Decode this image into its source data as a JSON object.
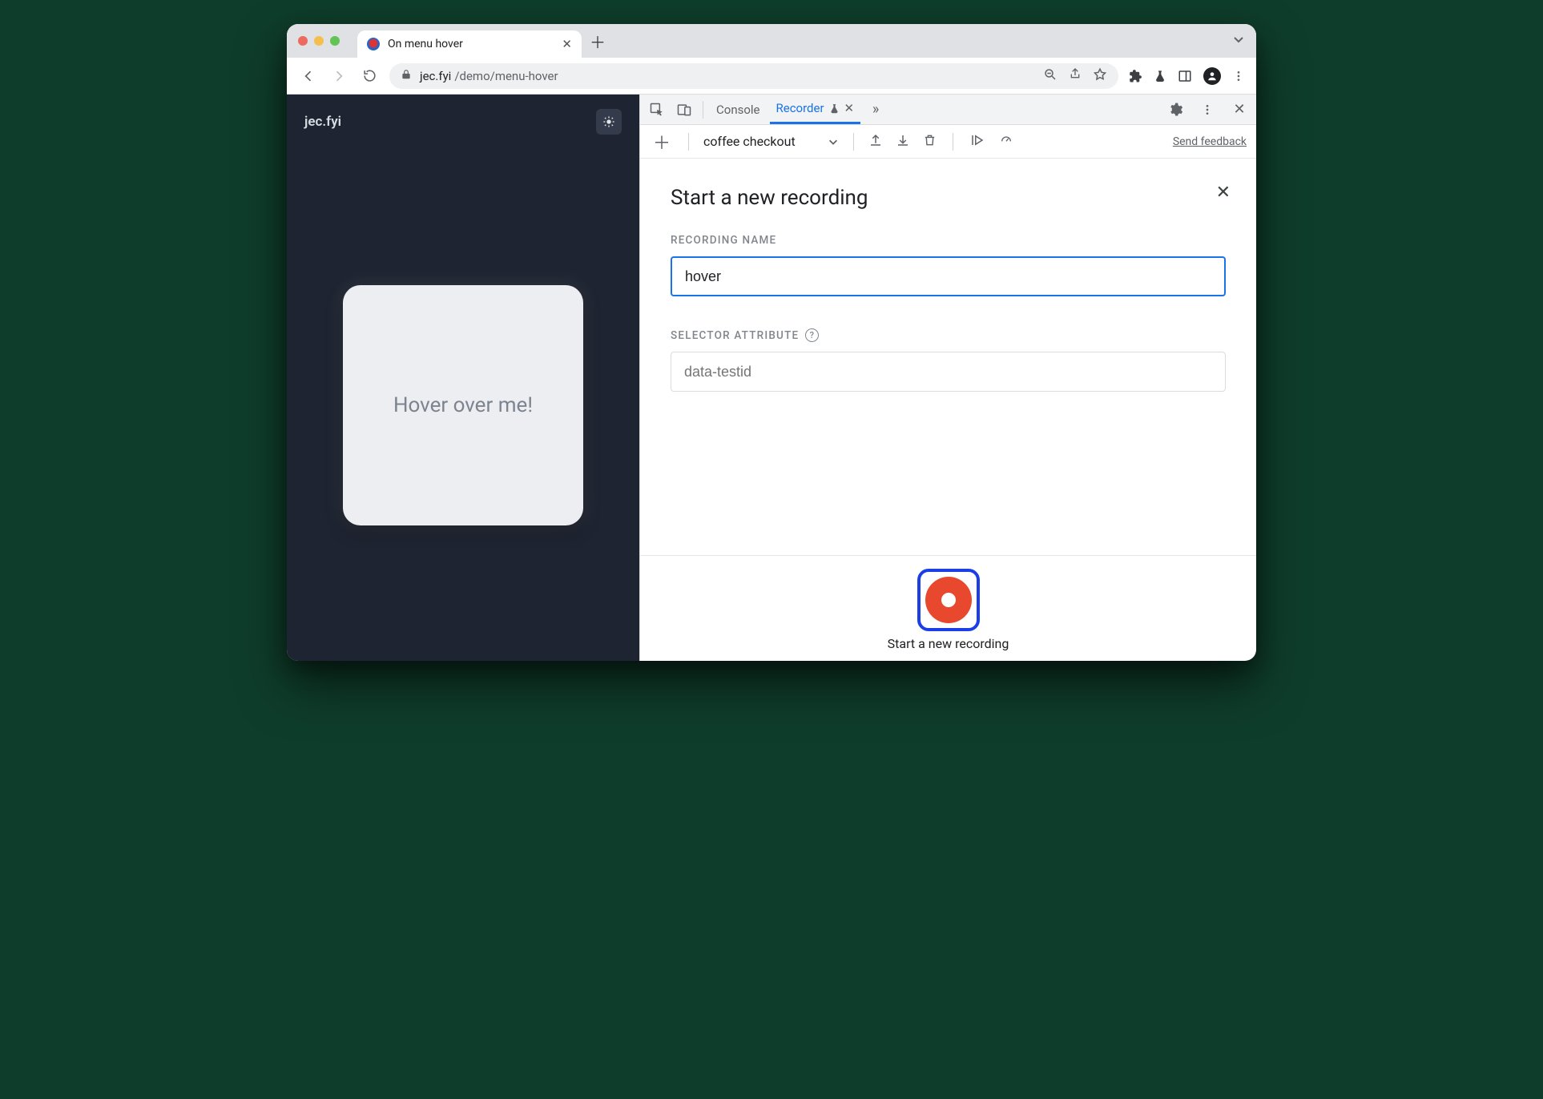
{
  "tab": {
    "title": "On menu hover"
  },
  "url": {
    "host": "jec.fyi",
    "path": "/demo/menu-hover"
  },
  "page": {
    "brand": "jec.fyi",
    "card_text": "Hover over me!"
  },
  "devtools": {
    "tabs": {
      "console": "Console",
      "recorder": "Recorder"
    },
    "recorder": {
      "dropdown": "coffee checkout",
      "feedback": "Send feedback",
      "heading": "Start a new recording",
      "fields": {
        "name_label": "RECORDING NAME",
        "name_value": "hover",
        "selector_label": "SELECTOR ATTRIBUTE",
        "selector_placeholder": "data-testid"
      },
      "button_label": "Start a new recording"
    }
  }
}
